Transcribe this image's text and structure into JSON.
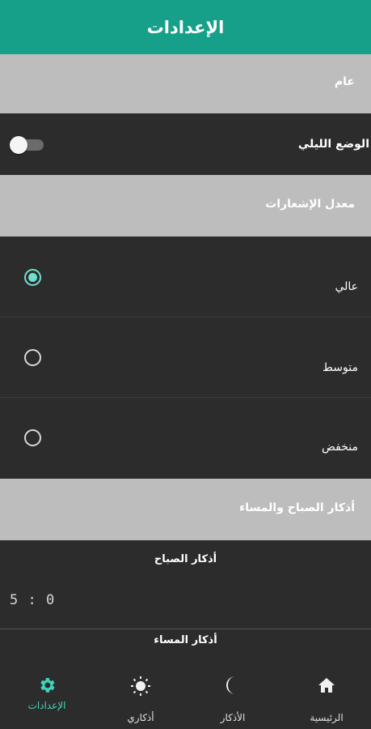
{
  "appbar": {
    "title": "الإعدادات"
  },
  "general": {
    "header": "عام",
    "night_mode_label": "الوضع الليلي",
    "night_mode_on": false
  },
  "notifications": {
    "header": "معدل الإشعارات",
    "options": [
      {
        "label": "عالي",
        "selected": true
      },
      {
        "label": "متوسط",
        "selected": false
      },
      {
        "label": "منخفض",
        "selected": false
      }
    ]
  },
  "azkar": {
    "header": "أذكار الصباح والمساء",
    "morning_title": "أذكار الصباح",
    "morning_time": "5 : 0",
    "evening_title": "أذكار المساء"
  },
  "bottom_nav": {
    "items": [
      {
        "label": "الرئيسية",
        "icon": "home-icon",
        "active": false
      },
      {
        "label": "الأذكار",
        "icon": "moon-icon",
        "active": false
      },
      {
        "label": "أذكاري",
        "icon": "sun-icon",
        "active": false
      },
      {
        "label": "الإعدادات",
        "icon": "gear-icon",
        "active": true
      }
    ],
    "active_color": "#3fd5bb"
  },
  "colors": {
    "primary": "#16a08a",
    "accent": "#6fe0cb",
    "section_bg": "#bdbdbd",
    "surface": "#2c2c2c"
  }
}
